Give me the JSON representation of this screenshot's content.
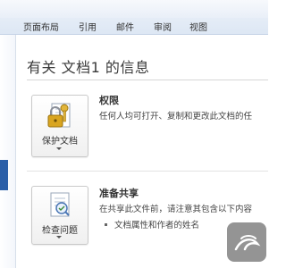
{
  "ribbon": {
    "tabs": [
      {
        "label": "页面布局"
      },
      {
        "label": "引用"
      },
      {
        "label": "邮件"
      },
      {
        "label": "审阅"
      },
      {
        "label": "视图"
      }
    ]
  },
  "info": {
    "title": "有关 文档1 的信息"
  },
  "permissions": {
    "button_label": "保护文档",
    "heading": "权限",
    "description": "任何人均可打开、复制和更改此文档的任"
  },
  "prepare": {
    "button_label": "检查问题",
    "heading": "准备共享",
    "description": "在共享此文件前，请注意其包含以下内容",
    "bullets": [
      "文档属性和作者的姓名"
    ]
  },
  "colors": {
    "accent": "#2a5fa8",
    "lock": "#d9a520",
    "key": "#e2b53a"
  },
  "icons": {
    "protect": "lock-key-icon",
    "inspect": "document-check-icon",
    "watermark": "watermark-logo"
  }
}
